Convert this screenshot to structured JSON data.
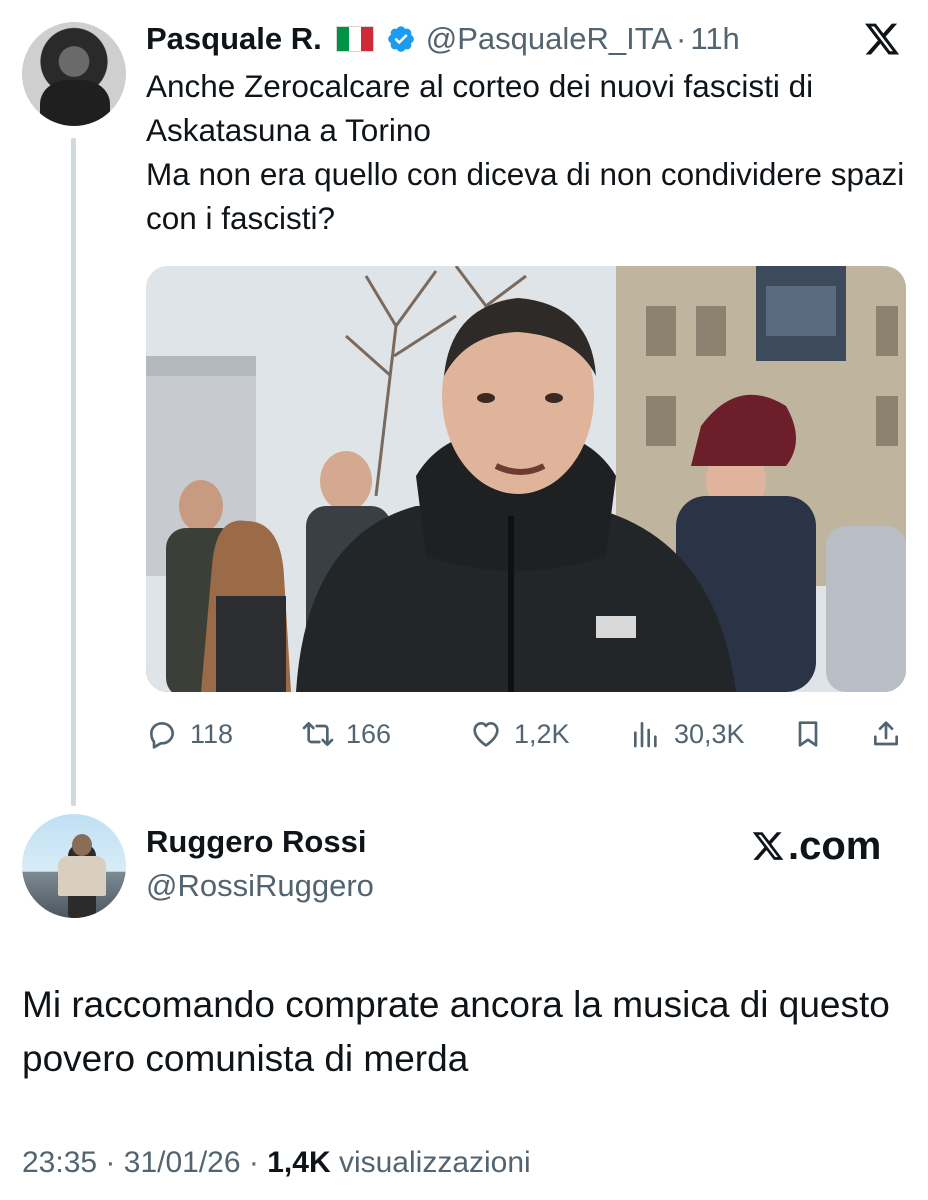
{
  "original_tweet": {
    "display_name": "Pasquale R.",
    "flag": "🇮🇹",
    "handle": "@PasqualeR_ITA",
    "separator": "·",
    "time": "11h",
    "text_lines": [
      "Anche Zerocalcare al corteo dei nuovi fascisti di Askatasuna a Torino",
      "Ma non era quello con diceva di non condividere spazi con i fascisti?"
    ],
    "actions": {
      "replies": "118",
      "retweets": "166",
      "likes": "1,2K",
      "views": "30,3K"
    },
    "icons": {
      "verified": "verified-badge-icon",
      "logo": "x-logo-icon",
      "reply": "reply-icon",
      "retweet": "retweet-icon",
      "like": "heart-icon",
      "views": "views-icon",
      "bookmark": "bookmark-icon",
      "share": "share-icon"
    },
    "colors": {
      "verified": "#1d9bf0",
      "secondary_text": "#536471",
      "primary_text": "#0f1419"
    }
  },
  "reply_tweet": {
    "display_name": "Ruggero Rossi",
    "handle": "@RossiRuggero",
    "brand_text": ".com",
    "text": "Mi raccomando comprate ancora la musica di questo povero comunista di merda",
    "meta": {
      "time": "23:35",
      "separator": "·",
      "date": "31/01/26",
      "views_count": "1,4K",
      "views_label": "visualizzazioni"
    }
  }
}
